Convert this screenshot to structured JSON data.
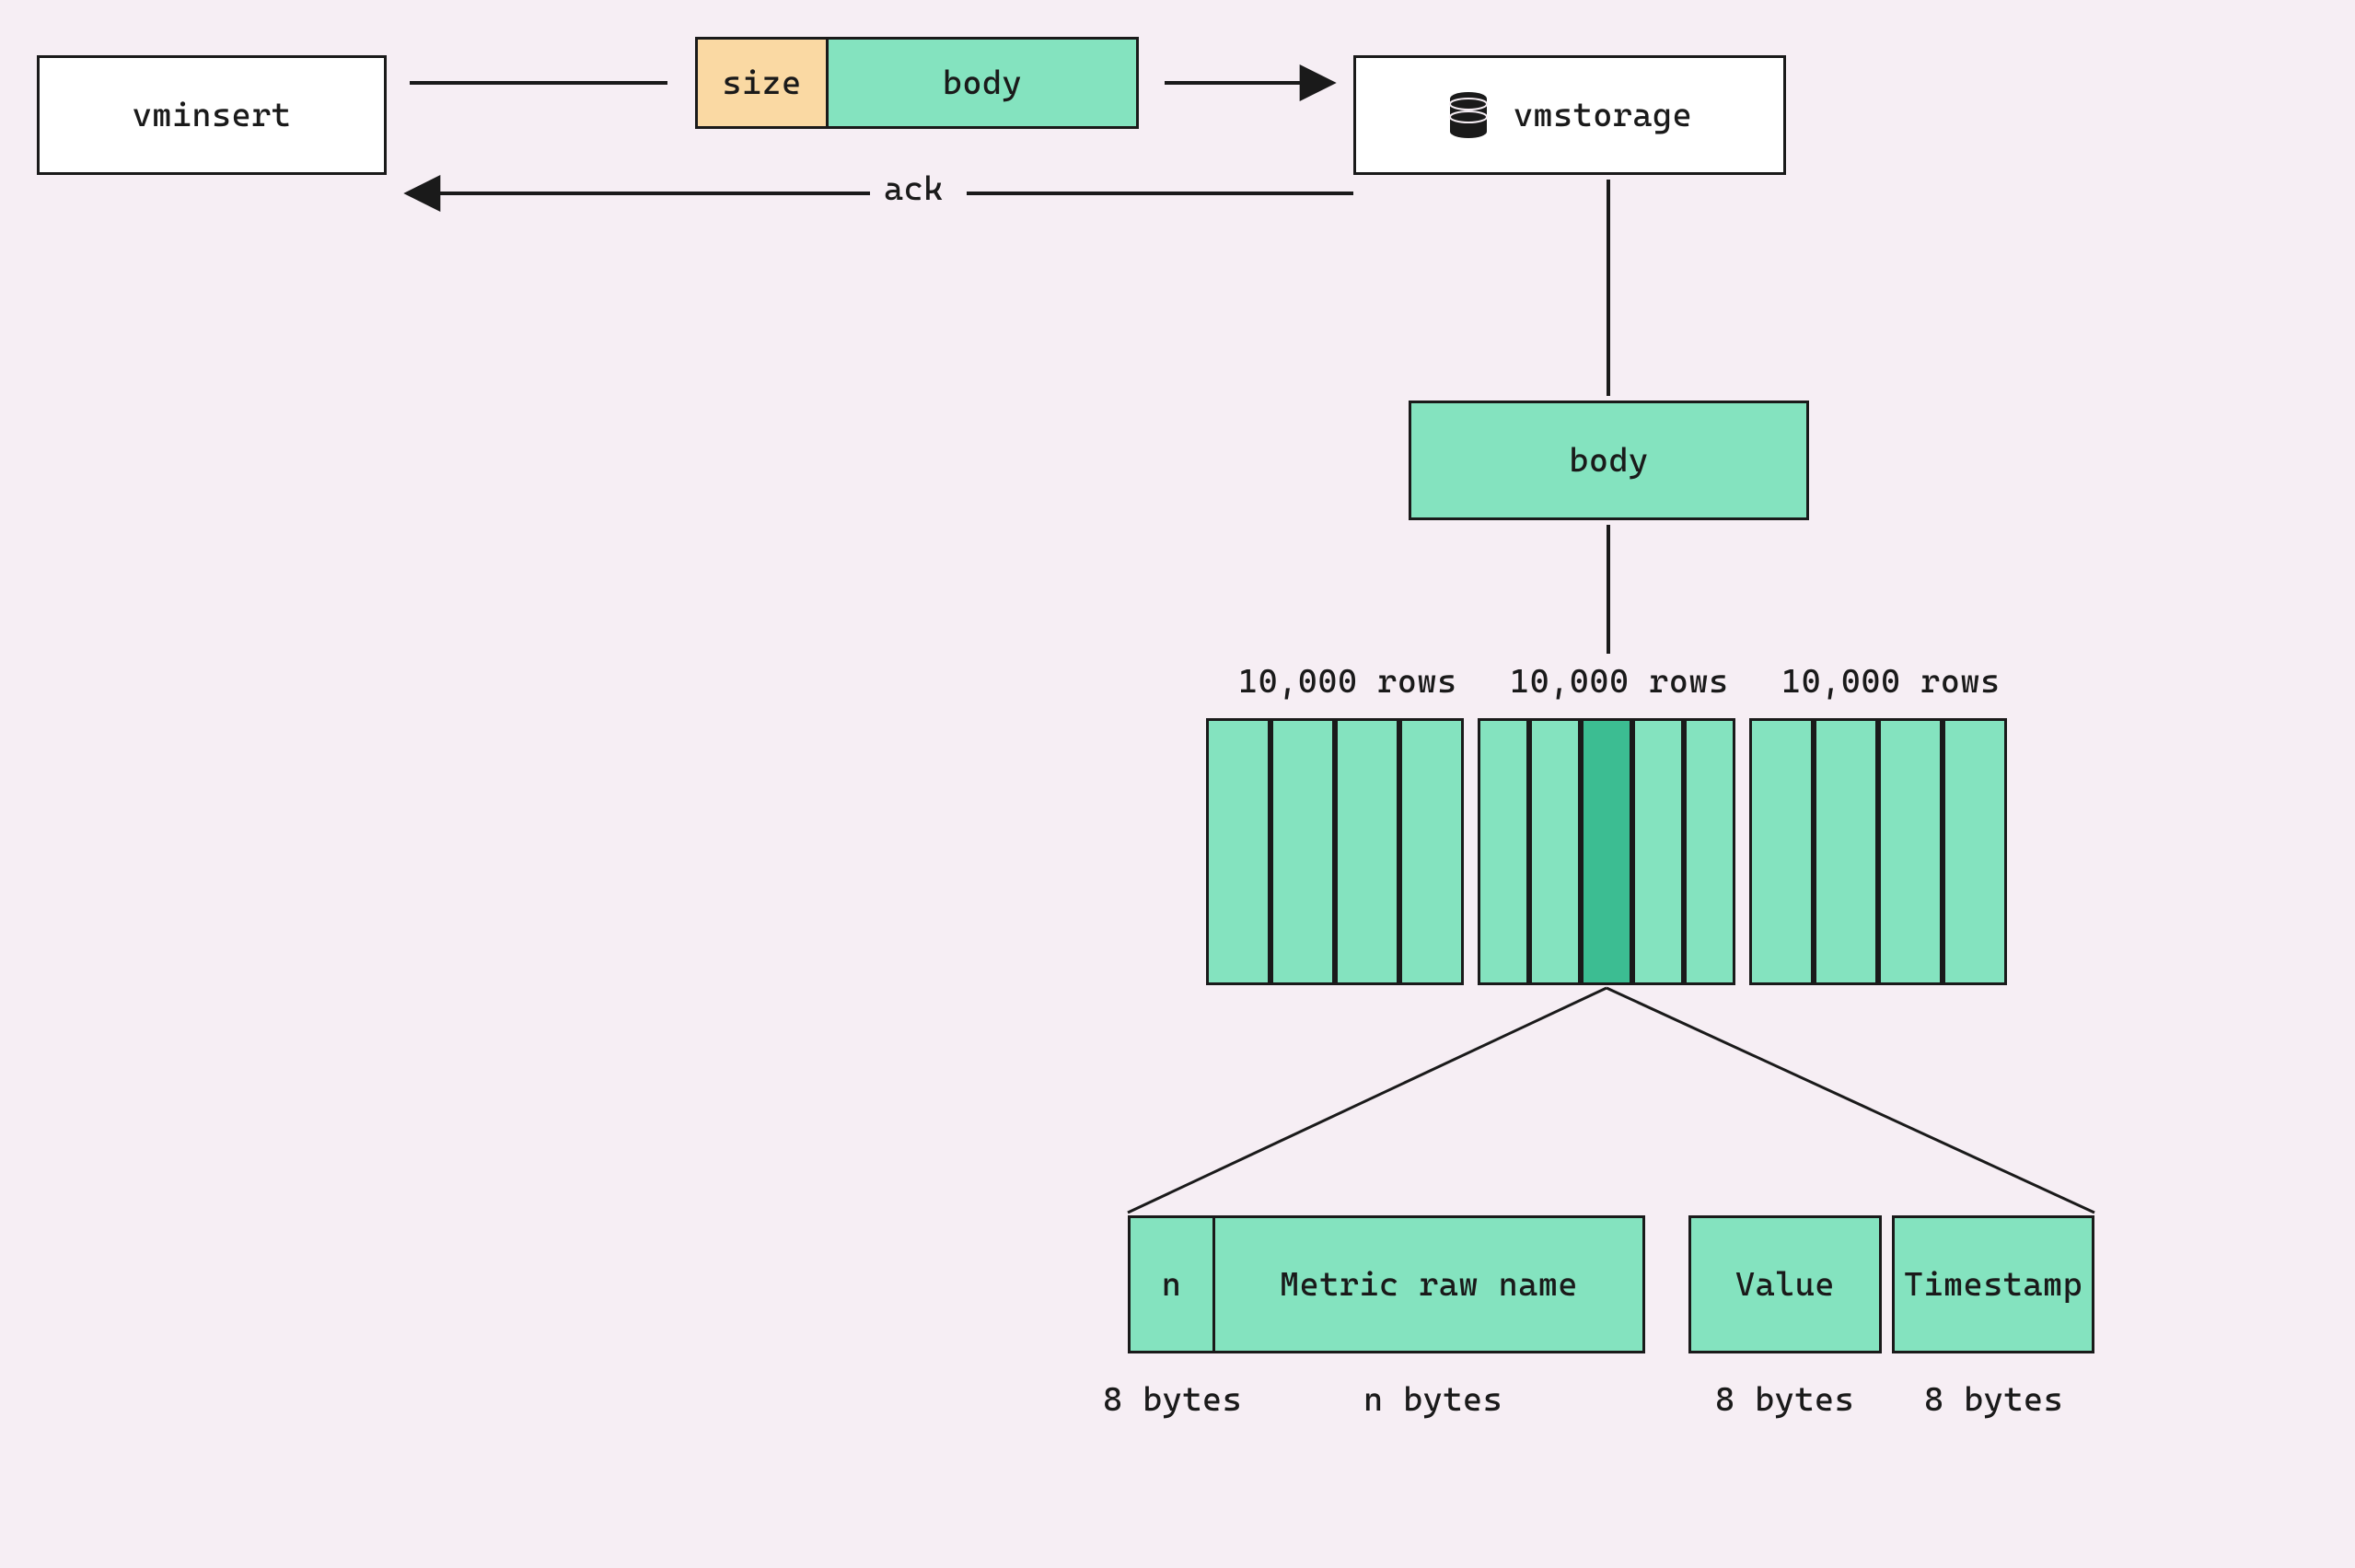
{
  "nodes": {
    "vminsert": "vminsert",
    "vmstorage": "vmstorage"
  },
  "packet": {
    "size": "size",
    "body": "body"
  },
  "ack": "ack",
  "body": "body",
  "rows_label": "10,000 rows",
  "row_struct": {
    "n": "n",
    "metric": "Metric raw name",
    "value": "Value",
    "timestamp": "Timestamp"
  },
  "row_bytes": {
    "n": "8 bytes",
    "metric": "n bytes",
    "value": "8 bytes",
    "timestamp": "8 bytes"
  },
  "colors": {
    "bg": "#f6eef4",
    "mint": "#84e3bf",
    "mint_dark": "#3cbd92",
    "peach": "#fad9a3",
    "line": "#1a1a1a",
    "white": "#ffffff"
  }
}
